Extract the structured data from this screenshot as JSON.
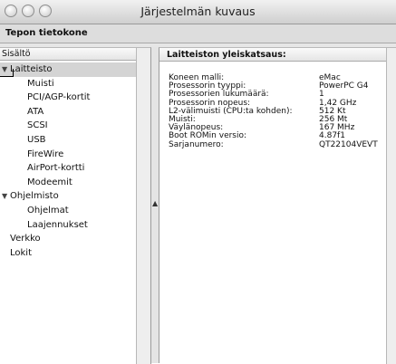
{
  "window": {
    "title": "Järjestelmän kuvaus"
  },
  "toolbar": {
    "machine_name": "Tepon tietokone"
  },
  "sidebar": {
    "header": "Sisältö",
    "items": [
      {
        "label": "Laitteisto",
        "level": 0,
        "expanded": true,
        "selected": true
      },
      {
        "label": "Muisti",
        "level": 1
      },
      {
        "label": "PCI/AGP-kortit",
        "level": 1
      },
      {
        "label": "ATA",
        "level": 1
      },
      {
        "label": "SCSI",
        "level": 1
      },
      {
        "label": "USB",
        "level": 1
      },
      {
        "label": "FireWire",
        "level": 1
      },
      {
        "label": "AirPort-kortti",
        "level": 1
      },
      {
        "label": "Modeemit",
        "level": 1
      },
      {
        "label": "Ohjelmisto",
        "level": 0,
        "expanded": true
      },
      {
        "label": "Ohjelmat",
        "level": 1
      },
      {
        "label": "Laajennukset",
        "level": 1
      },
      {
        "label": "Verkko",
        "level": 0
      },
      {
        "label": "Lokit",
        "level": 0
      }
    ]
  },
  "detail": {
    "title": "Laitteiston yleiskatsaus:",
    "rows": [
      {
        "key": "Koneen malli:",
        "value": "eMac"
      },
      {
        "key": "Prosessorin tyyppi:",
        "value": "PowerPC G4"
      },
      {
        "key": "Prosessorien lukumäärä:",
        "value": "1"
      },
      {
        "key": "Prosessorin nopeus:",
        "value": "1,42 GHz"
      },
      {
        "key": "L2-välimuisti (CPU:ta kohden):",
        "value": "512 Kt"
      },
      {
        "key": "Muisti:",
        "value": "256 Mt"
      },
      {
        "key": "Väylänopeus:",
        "value": "167 MHz"
      },
      {
        "key": "Boot ROMin versio:",
        "value": "4.87f1"
      },
      {
        "key": "Sarjanumero:",
        "value": "QT22104VEVT"
      }
    ]
  }
}
